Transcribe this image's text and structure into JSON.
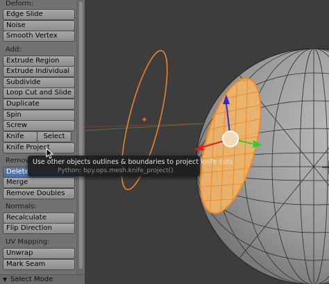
{
  "toolshelf": {
    "sections": {
      "deform": "Deform:",
      "add": "Add:",
      "remove": "Remove:",
      "normals": "Normals:",
      "uv_mapping": "UV Mapping:"
    },
    "buttons": {
      "edge_slide": "Edge Slide",
      "noise": "Noise",
      "smooth_vertex": "Smooth Vertex",
      "extrude_region": "Extrude Region",
      "extrude_individual": "Extrude Individual",
      "subdivide": "Subdivide",
      "loop_cut_and_slide": "Loop Cut and Slide",
      "duplicate": "Duplicate",
      "spin": "Spin",
      "screw": "Screw",
      "knife": "Knife",
      "select": "Select",
      "knife_project": "Knife Project",
      "delete": "Delete",
      "merge": "Merge",
      "remove_doubles": "Remove Doubles",
      "recalculate": "Recalculate",
      "flip_direction": "Flip Direction",
      "unwrap": "Unwrap",
      "mark_seam": "Mark Seam"
    },
    "bottom_panel": "Select Mode"
  },
  "tooltip": {
    "description": "Use other objects outlines & boundaries to project knife cuts",
    "python": "Python: bpy.ops.mesh.knife_project()"
  },
  "colors": {
    "selection_orange": "#f08a24",
    "manipulator_x": "#e0201a",
    "manipulator_y": "#2ad12a",
    "manipulator_z": "#2a2ad8",
    "active_button": "#5a7fb8"
  }
}
